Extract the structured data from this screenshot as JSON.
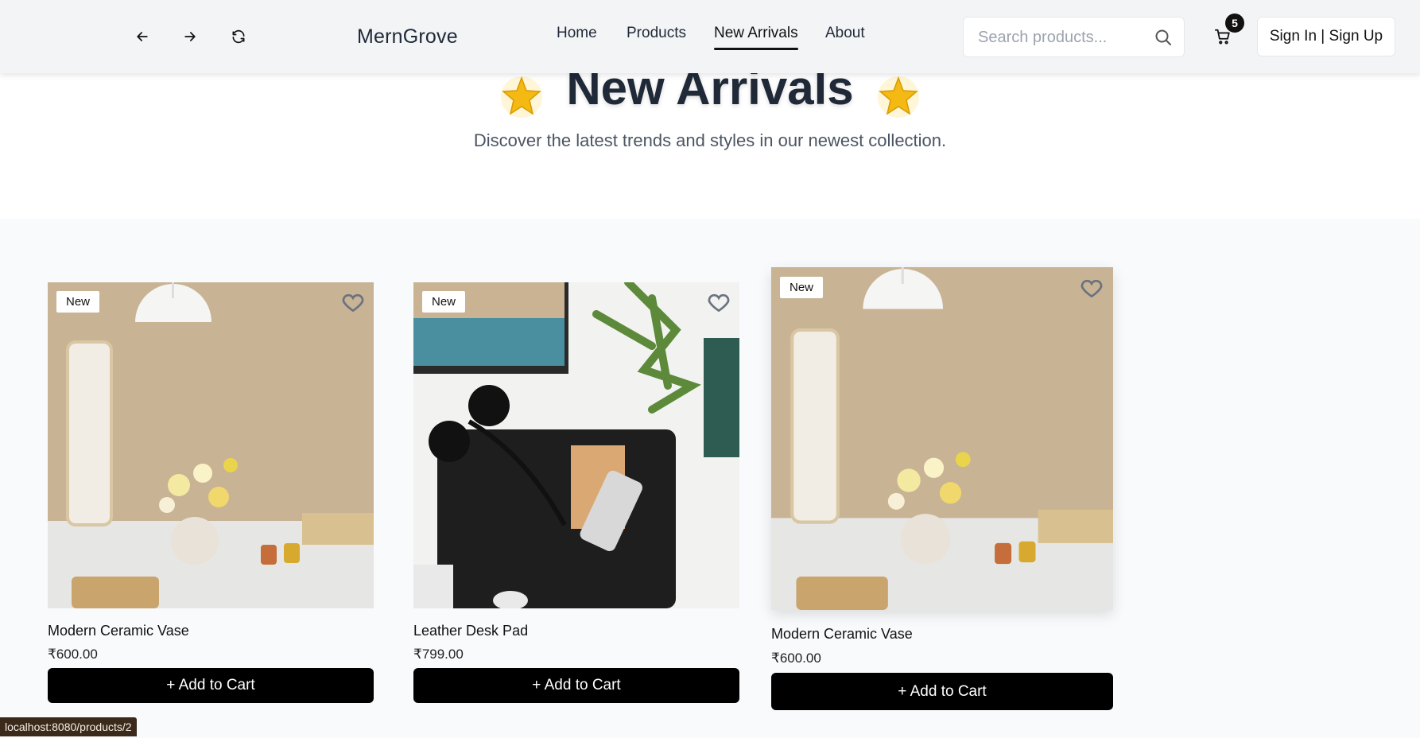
{
  "header": {
    "brand": "MernGrove",
    "menu": [
      {
        "label": "Home",
        "active": false
      },
      {
        "label": "Products",
        "active": false
      },
      {
        "label": "New Arrivals",
        "active": true
      },
      {
        "label": "About",
        "active": false
      }
    ],
    "search": {
      "placeholder": "Search products...",
      "value": ""
    },
    "cart_count": "5",
    "signin_label": "Sign In | Sign Up"
  },
  "hero": {
    "title": "New Arrivals",
    "subtitle": "Discover the latest trends and styles in our newest collection."
  },
  "products": [
    {
      "badge": "New",
      "name": "Modern Ceramic Vase",
      "price": "₹600.00",
      "button": "+ Add to Cart",
      "image": "vase-room"
    },
    {
      "badge": "New",
      "name": "Leather Desk Pad",
      "price": "₹799.00",
      "button": "+ Add to Cart",
      "image": "desk-pad"
    },
    {
      "badge": "New",
      "name": "Modern Ceramic Vase",
      "price": "₹600.00",
      "button": "+ Add to Cart",
      "image": "vase-room"
    }
  ],
  "status_url": "localhost:8080/products/2",
  "colors": {
    "accent": "#000000",
    "heading": "#1f2937",
    "header_bg": "#f3f4f6"
  }
}
